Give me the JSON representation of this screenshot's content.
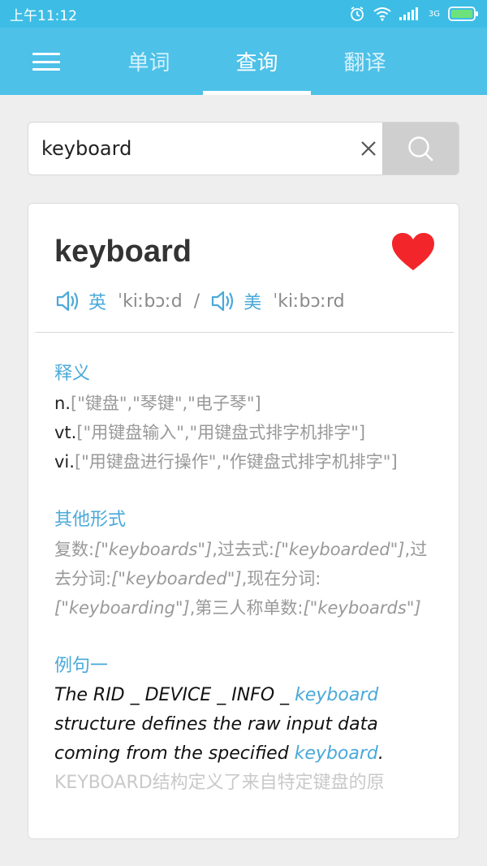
{
  "status": {
    "time": "上午11:12",
    "network": "3G"
  },
  "tabs": [
    "单词",
    "查询",
    "翻译"
  ],
  "search": {
    "value": "keyboard",
    "placeholder": ""
  },
  "word": "keyboard",
  "phonetics": {
    "uk_label": "英",
    "uk": "ˈkiːbɔːd",
    "separator": "/",
    "us_label": "美",
    "us": "ˈkiːbɔːrd"
  },
  "definitions": {
    "title": "释义",
    "items": [
      {
        "pos": "n.",
        "text": "[\"键盘\",\"琴键\",\"电子琴\"]"
      },
      {
        "pos": "vt.",
        "text": "[\"用键盘输入\",\"用键盘式排字机排字\"]"
      },
      {
        "pos": "vi.",
        "text": "[\"用键盘进行操作\",\"作键盘式排字机排字\"]"
      }
    ]
  },
  "other_forms": {
    "title": "其他形式",
    "items": [
      {
        "label": "复数:",
        "value": "[\"keyboards\"]",
        "sep": ","
      },
      {
        "label": "过去式:",
        "value": "[\"keyboarded\"]",
        "sep": ","
      },
      {
        "label": "过去分词:",
        "value": "[\"keyboarded\"]",
        "sep": ","
      },
      {
        "label": "现在分词:",
        "value": "[\"keyboarding\"]",
        "sep": ","
      },
      {
        "label": "第三人称单数:",
        "value": "[\"keyboards\"]",
        "sep": ""
      }
    ]
  },
  "example": {
    "title": "例句一",
    "p1": "The RID _ DEVICE _ INFO _ ",
    "h1": "keyboard",
    "p2": " structure defines the raw input data coming from the specified ",
    "h2": "keyboard",
    "p3": ".",
    "translation": "KEYBOARD结构定义了来自特定键盘的原"
  },
  "colors": {
    "header": "#4dc1e8",
    "status_bar": "#3dbde5",
    "accent": "#4aa9d9",
    "heart": "#f2262a",
    "search_button": "#cfcfcf"
  }
}
